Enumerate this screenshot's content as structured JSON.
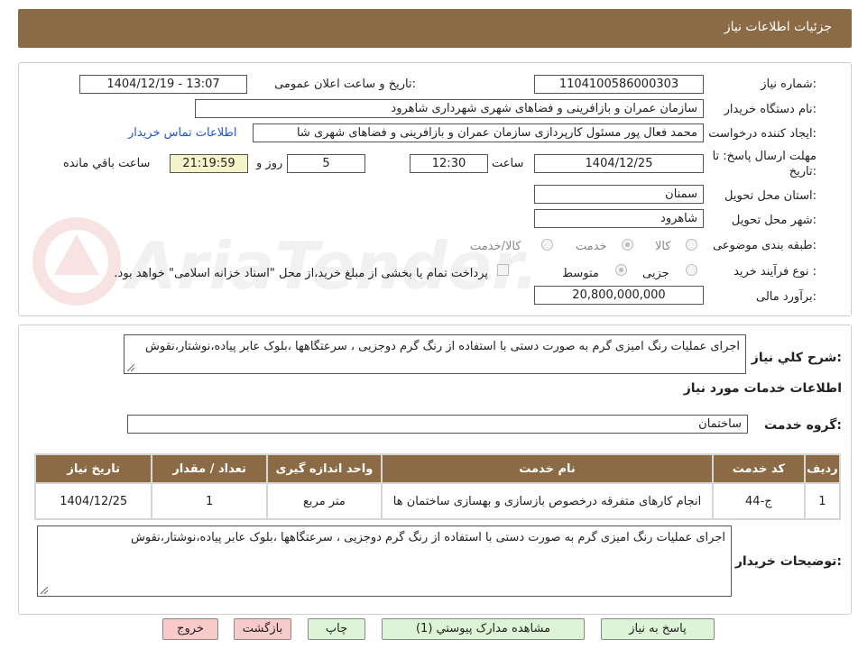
{
  "header": {
    "title": "جزئیات اطلاعات نیاز"
  },
  "form": {
    "need_number_label": "شماره نیاز:",
    "need_number": "1104100586000303",
    "announce_label": "تاریخ و ساعت اعلان عمومی:",
    "announce_value": "1404/12/19 - 13:07",
    "buyer_org_label": "نام دستگاه خریدار:",
    "buyer_org": "سازمان عمران و بازافرینی و فضاهای شهری شهرداری شاهرود",
    "creator_label": "ایجاد کننده درخواست:",
    "creator": "محمد فعال پور مسئول کارپردازی سازمان عمران و بازافرینی و فضاهای شهری شا",
    "contact_link": "اطلاعات تماس خریدار",
    "deadline_label_1": "مهلت ارسال پاسخ: تا",
    "deadline_label_2": "تاریخ:",
    "deadline_date": "1404/12/25",
    "time_label": "ساعت",
    "deadline_time": "12:30",
    "days_value": "5",
    "days_label": "روز و",
    "remaining_time": "21:19:59",
    "remaining_label": "ساعت باقي مانده",
    "province_label": "استان محل تحویل:",
    "province": "سمنان",
    "city_label": "شهر محل تحویل:",
    "city": "شاهرود",
    "category_label": "طبقه بندی موضوعی:",
    "category_options": [
      "کالا",
      "خدمت",
      "کالا/خدمت"
    ],
    "process_label": "نوع فرآیند خرید :",
    "process_options": [
      "جزیی",
      "متوسط"
    ],
    "payment_note": "پرداخت تمام یا بخشی از مبلغ خرید،از محل \"اسناد خزانه اسلامی\" خواهد بود.",
    "budget_label": "برآورد مالی:",
    "budget": "20,800,000,000"
  },
  "watermark": {
    "text": "AriaTender.net"
  },
  "general": {
    "desc_label": "شرح کلي نياز:",
    "desc": "اجرای عملیات رنگ امیزی گرم به صورت دستی با استفاده از رنگ گرم دوجزیی ، سرعتگاهها ،بلوک عابر پیاده،نوشتار،نقوش",
    "services_title": "اطلاعات خدمات مورد نياز",
    "service_group_label": "گروه خدمت:",
    "service_group": "ساختمان"
  },
  "table": {
    "headers": [
      "رديف",
      "کد خدمت",
      "نام خدمت",
      "واحد اندازه گيری",
      "تعداد / مقدار",
      "تاریخ نیاز"
    ],
    "rows": [
      [
        "1",
        "ج-44",
        "انجام کارهای متفرقه درخصوص بازسازی و بهسازی ساختمان ها",
        "متر مربع",
        "1",
        "1404/12/25"
      ]
    ]
  },
  "buyer_notes": {
    "label": "توضيحات خريدار:",
    "text": "اجرای عملیات رنگ امیزی گرم به صورت دستی با استفاده از رنگ گرم دوجزیی ، سرعتگاهها ،بلوک عابر پیاده،نوشتار،نقوش"
  },
  "buttons": {
    "reply": "پاسخ به نياز",
    "attachments": "مشاهده مدارک پيوستي (1)",
    "print": "چاپ",
    "back": "بازگشت",
    "exit": "خروج"
  },
  "colors": {
    "header_bg": "#8b6b45",
    "button_green": "#ddf5d6",
    "button_pink": "#f8caca",
    "remaining_bg": "#f5f3c9"
  }
}
